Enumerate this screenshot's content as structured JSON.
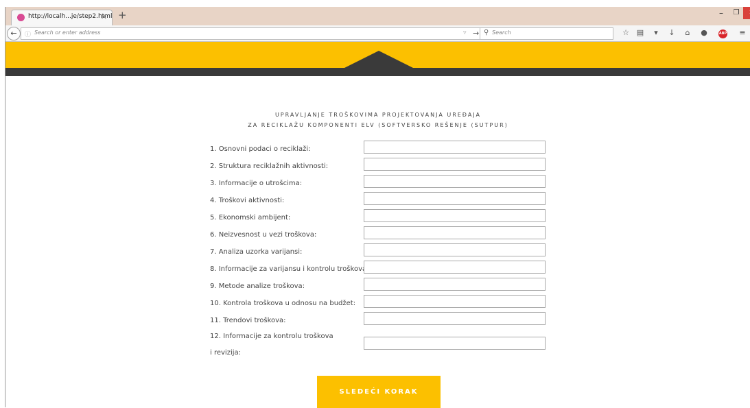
{
  "browser": {
    "tab_title": "http://localh...je/step2.html",
    "tab_close": "✕",
    "new_tab": "+",
    "url_placeholder": "Search or enter address",
    "search_placeholder": "Search",
    "window_minimize": "–",
    "window_maximize": "❐",
    "window_close": "✕"
  },
  "page": {
    "heading_line1": "UPRAVLJANJE TROŠKOVIMA PROJEKTOVANJA UREĐAJA",
    "heading_line2": "ZA RECIKLAŽU KOMPONENTI ELV (SOFTVERSKO REŠENJE (SUTPUR)",
    "fields": [
      {
        "label": "1. Osnovni podaci o reciklaži:",
        "value": ""
      },
      {
        "label": "2. Struktura reciklažnih aktivnosti:",
        "value": ""
      },
      {
        "label": "3. Informacije o utrošcima:",
        "value": ""
      },
      {
        "label": "4. Troškovi aktivnosti:",
        "value": ""
      },
      {
        "label": "5. Ekonomski ambijent:",
        "value": ""
      },
      {
        "label": "6. Neizvesnost u vezi troškova:",
        "value": ""
      },
      {
        "label": "7. Analiza uzorka varijansi:",
        "value": ""
      },
      {
        "label": "8. Informacije za varijansu i kontrolu troškova:",
        "value": ""
      },
      {
        "label": "9. Metode analize troškova:",
        "value": ""
      },
      {
        "label": "10. Kontrola troškova u odnosu na budžet:",
        "value": ""
      },
      {
        "label": "11. Trendovi troškova:",
        "value": ""
      },
      {
        "label": "12. Informacije za kontrolu troškova",
        "label_line2": "i revizija:",
        "value": ""
      }
    ],
    "next_button": "SLEDEĆI KORAK"
  },
  "colors": {
    "accent_yellow": "#fcc000",
    "dark_band": "#3a3a3a"
  },
  "icons": [
    "back-arrow-icon",
    "info-icon",
    "dropdown-icon",
    "go-arrow-icon",
    "search-icon",
    "bookmark-star-icon",
    "reading-list-icon",
    "pocket-icon",
    "download-icon",
    "home-icon",
    "chat-icon",
    "adblock-icon",
    "hamburger-menu-icon"
  ]
}
